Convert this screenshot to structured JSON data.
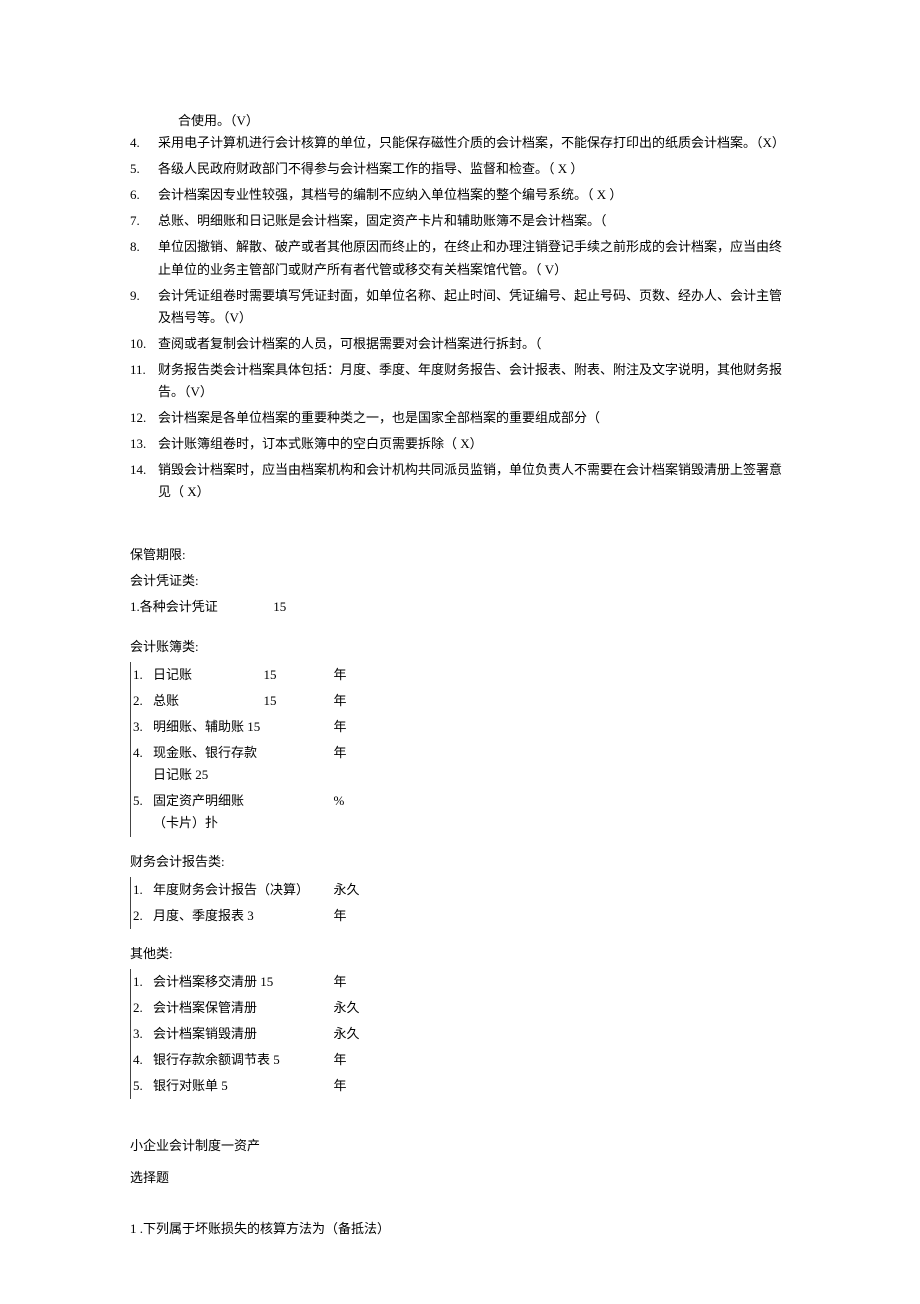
{
  "top_fragment": "合使用。（V）",
  "questions": [
    {
      "n": "4.",
      "t": "采用电子计算机进行会计核算的单位，只能保存磁性介质的会计档案，不能保存打印出的纸质会计档案。（X）"
    },
    {
      "n": "5.",
      "t": "各级人民政府财政部门不得参与会计档案工作的指导、监督和检查。（ X ）"
    },
    {
      "n": "6.",
      "t": "会计档案因专业性较强，其档号的编制不应纳入单位档案的整个编号系统。（ X ）"
    },
    {
      "n": "7.",
      "t": "总账、明细账和日记账是会计档案，固定资产卡片和辅助账簿不是会计档案。（"
    },
    {
      "n": "8.",
      "t": "单位因撤销、解散、破产或者其他原因而终止的，在终止和办理注销登记手续之前形成的会计档案，应当由终止单位的业务主管部门或财产所有者代管或移交有关档案馆代管。（          V）"
    },
    {
      "n": "9.",
      "t": "会计凭证组卷时需要填写凭证封面，如单位名称、起止时间、凭证编号、起止号码、页数、经办人、会计主管及档号等。（V）"
    },
    {
      "n": "10.",
      "t": "查阅或者复制会计档案的人员，可根据需要对会计档案进行拆封。（"
    },
    {
      "n": "11.",
      "t": "财务报告类会计档案具体包括：月度、季度、年度财务报告、会计报表、附表、附注及文字说明，其他财务报告。（V）"
    },
    {
      "n": "12.",
      "t": "会计档案是各单位档案的重要种类之一，也是国家全部档案的重要组成部分（"
    },
    {
      "n": "13.",
      "t": "会计账簿组卷时，订本式账簿中的空白页需要拆除（      X）"
    },
    {
      "n": "14.",
      "t": "销毁会计档案时，应当由档案机构和会计机构共同派员监销，单位负责人不需要在会计档案销毁清册上签署意见（ X）"
    }
  ],
  "retention": {
    "header": "保管期限:",
    "voucher_header": "会计凭证类:",
    "voucher_line_label": "1.各种会计凭证",
    "voucher_line_val": "15",
    "ledger_header": "会计账簿类:",
    "ledger_rows": [
      {
        "n": "1.",
        "name": "日记账",
        "val": "15",
        "unit": "年"
      },
      {
        "n": "2.",
        "name": "总账",
        "val": "15",
        "unit": "年"
      },
      {
        "n": "3.",
        "name": "明细账、辅助账 15",
        "val": "",
        "unit": "年"
      },
      {
        "n": "4.",
        "name": "现金账、银行存款日记账 25",
        "val": "",
        "unit": "年"
      },
      {
        "n": "5.",
        "name": "固定资产明细账（卡片）扑",
        "val": "",
        "unit": "%"
      }
    ],
    "report_header": "财务会计报告类:",
    "report_rows": [
      {
        "n": "1.",
        "name": "年度财务会计报告（决算）",
        "val": "",
        "unit": "永久"
      },
      {
        "n": "2.",
        "name": "月度、季度报表 3",
        "val": "",
        "unit": "年"
      }
    ],
    "other_header": "其他类:",
    "other_rows": [
      {
        "n": "1.",
        "name": "会计档案移交清册 15",
        "val": "",
        "unit": "年"
      },
      {
        "n": "2.",
        "name": "会计档案保管清册",
        "val": "",
        "unit": "永久"
      },
      {
        "n": "3.",
        "name": "会计档案销毁清册",
        "val": "",
        "unit": "永久"
      },
      {
        "n": "4.",
        "name": "银行存款余额调节表 5",
        "val": "",
        "unit": "年"
      },
      {
        "n": "5.",
        "name": "银行对账单 5",
        "val": "",
        "unit": "年"
      }
    ]
  },
  "bottom": {
    "title": "小企业会计制度一资产",
    "subtitle": "选择题",
    "q1": "1 .下列属于坏账损失的核算方法为（备抵法）"
  }
}
